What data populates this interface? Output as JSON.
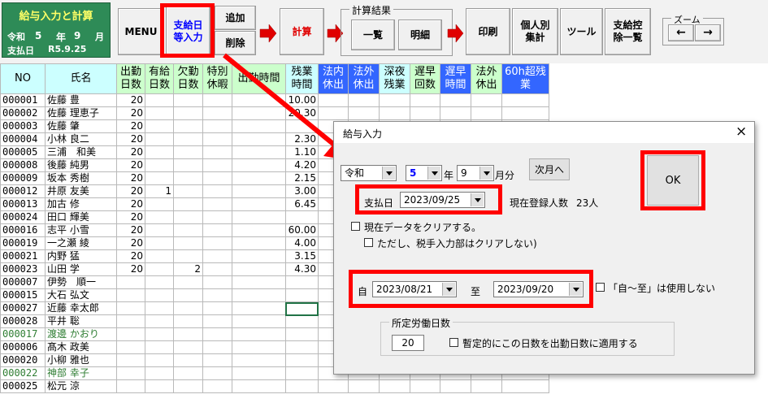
{
  "app": {
    "title": "給与入力と計算",
    "era": "令和",
    "year": "5",
    "year_unit": "年",
    "month": "9",
    "month_unit": "月",
    "payday_label": "支払日",
    "payday": "R5.9.25"
  },
  "toolbar": {
    "menu": "MENU",
    "payday_entry": "支給日\n等入力",
    "add": "追加",
    "delete": "削除",
    "calc": "計算",
    "results_label": "計算結果",
    "list": "一覧",
    "detail": "明細",
    "print": "印刷",
    "per_person": "個人別\n集計",
    "tools": "ツール",
    "deduction_list": "支給控\n除一覧",
    "zoom_label": "ズーム",
    "zoom_out": "←",
    "zoom_in": "→"
  },
  "sheet": {
    "headers": [
      "NO",
      "氏名",
      "出勤\n日数",
      "有給\n日数",
      "欠勤\n日数",
      "特別\n休暇",
      "出勤時間",
      "残業\n時間",
      "法内\n休出",
      "法外\n休出",
      "深夜\n残業",
      "遅早\n回数",
      "遅早\n時間",
      "法外\n休出",
      "60h超残\n業"
    ],
    "rows": [
      {
        "no": "000001",
        "name": "佐藤 豊",
        "days": "20",
        "paid": "",
        "absent": "",
        "ot": "10.00"
      },
      {
        "no": "000002",
        "name": "佐藤 理恵子",
        "days": "20",
        "paid": "",
        "absent": "",
        "ot": "20.30"
      },
      {
        "no": "000003",
        "name": "佐藤 肇",
        "days": "20",
        "paid": "",
        "absent": "",
        "ot": ""
      },
      {
        "no": "000004",
        "name": "小林 良二",
        "days": "20",
        "paid": "",
        "absent": "",
        "ot": "2.30"
      },
      {
        "no": "000005",
        "name": "三浦　和美",
        "days": "20",
        "paid": "",
        "absent": "",
        "ot": "1.10"
      },
      {
        "no": "000008",
        "name": "後藤 純男",
        "days": "20",
        "paid": "",
        "absent": "",
        "ot": "4.20"
      },
      {
        "no": "000009",
        "name": "坂本 秀樹",
        "days": "20",
        "paid": "",
        "absent": "",
        "ot": "2.15"
      },
      {
        "no": "000012",
        "name": "井原 友美",
        "days": "20",
        "paid": "1",
        "absent": "",
        "ot": "3.00"
      },
      {
        "no": "000013",
        "name": "加古 修",
        "days": "20",
        "paid": "",
        "absent": "",
        "ot": "6.45"
      },
      {
        "no": "000024",
        "name": "田口 輝美",
        "days": "20",
        "paid": "",
        "absent": "",
        "ot": ""
      },
      {
        "no": "000016",
        "name": "志平 小雪",
        "days": "20",
        "paid": "",
        "absent": "",
        "ot": "60.00"
      },
      {
        "no": "000019",
        "name": "一之瀬 綾",
        "days": "20",
        "paid": "",
        "absent": "",
        "ot": "4.00"
      },
      {
        "no": "000021",
        "name": "内野 猛",
        "days": "20",
        "paid": "",
        "absent": "",
        "ot": "3.15"
      },
      {
        "no": "000023",
        "name": "山田 学",
        "days": "20",
        "paid": "",
        "absent": "2",
        "ot": "4.30"
      },
      {
        "no": "000007",
        "name": "伊勢　順一",
        "days": "",
        "paid": "",
        "absent": "",
        "ot": ""
      },
      {
        "no": "000015",
        "name": "大石 弘文",
        "days": "",
        "paid": "",
        "absent": "",
        "ot": ""
      },
      {
        "no": "000027",
        "name": "近藤 幸太郎",
        "days": "",
        "paid": "",
        "absent": "",
        "ot": ""
      },
      {
        "no": "000028",
        "name": "平井 聡",
        "days": "",
        "paid": "",
        "absent": "",
        "ot": ""
      },
      {
        "no": "000017",
        "name": "渡邊 かおり",
        "days": "",
        "paid": "",
        "absent": "",
        "ot": "",
        "green": true
      },
      {
        "no": "000006",
        "name": "髙木 政美",
        "days": "",
        "paid": "",
        "absent": "",
        "ot": ""
      },
      {
        "no": "000020",
        "name": "小柳 雅也",
        "days": "",
        "paid": "",
        "absent": "",
        "ot": ""
      },
      {
        "no": "000022",
        "name": "神部 幸子",
        "days": "",
        "paid": "",
        "absent": "",
        "ot": "",
        "green": true
      },
      {
        "no": "000025",
        "name": "松元 涼",
        "days": "",
        "paid": "",
        "absent": "",
        "ot": ""
      }
    ]
  },
  "dialog": {
    "title": "給与入力",
    "close": "×",
    "era": "令和",
    "year": "5",
    "year_unit": "年",
    "month": "9",
    "month_unit": "月分",
    "next_month": "次月へ",
    "ok": "OK",
    "payday_label": "支払日",
    "payday": "2023/09/25",
    "registered_label": "現在登録人数",
    "registered_count": "23人",
    "clear_data": "現在データをクリアする。",
    "clear_note": "ただし、税手入力部はクリアしない)",
    "from_label": "自",
    "from_date": "2023/08/21",
    "to_label": "至",
    "to_date": "2023/09/20",
    "no_range": "「自～至」は使用しない",
    "workdays_group": "所定労働日数",
    "workdays": "20",
    "apply_workdays": "暫定的にこの日数を出勤日数に適用する"
  },
  "colors": {
    "title_bg": "#2e8b57",
    "highlight": "#ff0000",
    "header_blue": "#3366ff",
    "header_cyan": "#ccffff",
    "header_green": "#ccffcc",
    "payday_btn_text": "#0000ff"
  }
}
